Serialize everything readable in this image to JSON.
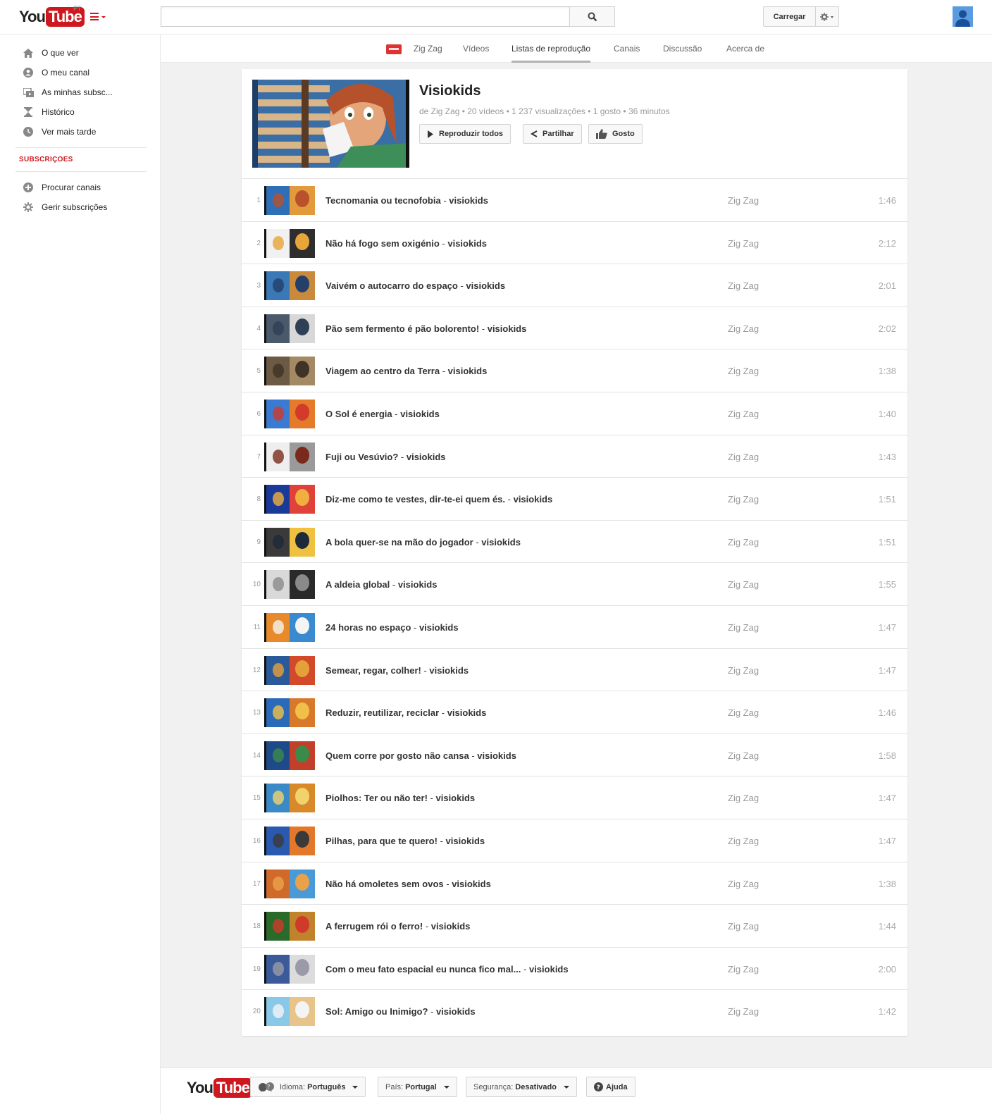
{
  "masthead": {
    "logo_you": "You",
    "logo_tube": "Tube",
    "country_code": "PT",
    "search_placeholder": "",
    "upload_label": "Carregar"
  },
  "guide": {
    "items": [
      {
        "label": "O que ver",
        "icon": "home-icon"
      },
      {
        "label": "O meu canal",
        "icon": "user-circle-icon"
      },
      {
        "label": "As minhas subsc...",
        "icon": "subscriptions-icon"
      },
      {
        "label": "Histórico",
        "icon": "hourglass-icon"
      },
      {
        "label": "Ver mais tarde",
        "icon": "clock-icon"
      }
    ],
    "subscriptions_heading": "SUBSCRIÇOES",
    "sub_items": [
      {
        "label": "Procurar canais",
        "icon": "plus-circle-icon"
      },
      {
        "label": "Gerir subscrições",
        "icon": "gear-icon"
      }
    ]
  },
  "channel_nav": {
    "tabs": [
      "Zig Zag",
      "Vídeos",
      "Listas de reprodução",
      "Canais",
      "Discussão",
      "Acerca de"
    ],
    "active_tab": "Listas de reprodução"
  },
  "playlist": {
    "title": "Visiokids",
    "meta": "de Zig Zag • 20 vídeos • 1 237 visualizações • 1 gosto • 36 minutos",
    "play_all_label": "Reproduzir todos",
    "share_label": "Partilhar",
    "like_label": "Gosto",
    "videos": [
      {
        "index": "1",
        "title": "Tecnomania ou tecnofobia",
        "suffix": "visiokids",
        "owner": "Zig Zag",
        "duration": "1:46"
      },
      {
        "index": "2",
        "title": "Não há fogo sem oxigénio",
        "suffix": "visiokids",
        "owner": "Zig Zag",
        "duration": "2:12"
      },
      {
        "index": "3",
        "title": "Vaivém o autocarro do espaço",
        "suffix": "visiokids",
        "owner": "Zig Zag",
        "duration": "2:01"
      },
      {
        "index": "4",
        "title": "Pão sem fermento é pão bolorento!",
        "suffix": "visiokids",
        "owner": "Zig Zag",
        "duration": "2:02"
      },
      {
        "index": "5",
        "title": "Viagem ao centro da Terra",
        "suffix": "visiokids",
        "owner": "Zig Zag",
        "duration": "1:38"
      },
      {
        "index": "6",
        "title": "O Sol é energia",
        "suffix": "visiokids",
        "owner": "Zig Zag",
        "duration": "1:40"
      },
      {
        "index": "7",
        "title": "Fuji ou Vesúvio?",
        "suffix": "visiokids",
        "owner": "Zig Zag",
        "duration": "1:43"
      },
      {
        "index": "8",
        "title": "Diz-me como te vestes, dir-te-ei quem és.",
        "suffix": "visiokids",
        "owner": "Zig Zag",
        "duration": "1:51"
      },
      {
        "index": "9",
        "title": "A bola quer-se na mão do jogador",
        "suffix": "visiokids",
        "owner": "Zig Zag",
        "duration": "1:51"
      },
      {
        "index": "10",
        "title": "A aldeia global",
        "suffix": "visiokids",
        "owner": "Zig Zag",
        "duration": "1:55"
      },
      {
        "index": "11",
        "title": "24 horas no espaço",
        "suffix": "visiokids",
        "owner": "Zig Zag",
        "duration": "1:47"
      },
      {
        "index": "12",
        "title": "Semear, regar, colher!",
        "suffix": "visiokids",
        "owner": "Zig Zag",
        "duration": "1:47"
      },
      {
        "index": "13",
        "title": "Reduzir, reutilizar, reciclar",
        "suffix": "visiokids",
        "owner": "Zig Zag",
        "duration": "1:46"
      },
      {
        "index": "14",
        "title": "Quem corre por gosto não cansa",
        "suffix": "visiokids",
        "owner": "Zig Zag",
        "duration": "1:58"
      },
      {
        "index": "15",
        "title": "Piolhos: Ter ou não ter!",
        "suffix": "visiokids",
        "owner": "Zig Zag",
        "duration": "1:47"
      },
      {
        "index": "16",
        "title": "Pilhas, para que te quero!",
        "suffix": "visiokids",
        "owner": "Zig Zag",
        "duration": "1:47"
      },
      {
        "index": "17",
        "title": "Não há omoletes sem ovos",
        "suffix": "visiokids",
        "owner": "Zig Zag",
        "duration": "1:38"
      },
      {
        "index": "18",
        "title": "A ferrugem rói o ferro!",
        "suffix": "visiokids",
        "owner": "Zig Zag",
        "duration": "1:44"
      },
      {
        "index": "19",
        "title": "Com o meu fato espacial eu nunca fico mal...",
        "suffix": "visiokids",
        "owner": "Zig Zag",
        "duration": "2:00"
      },
      {
        "index": "20",
        "title": "Sol: Amigo ou Inimigo?",
        "suffix": "visiokids",
        "owner": "Zig Zag",
        "duration": "1:42"
      }
    ]
  },
  "footer": {
    "language_key": "Idioma:",
    "language_value": "Português",
    "country_key": "País:",
    "country_value": "Portugal",
    "safety_key": "Segurança:",
    "safety_value": "Desativado",
    "help_label": "Ajuda"
  },
  "colors": {
    "brand_red": "#cc181e",
    "page_bg": "#f1f1f1"
  }
}
